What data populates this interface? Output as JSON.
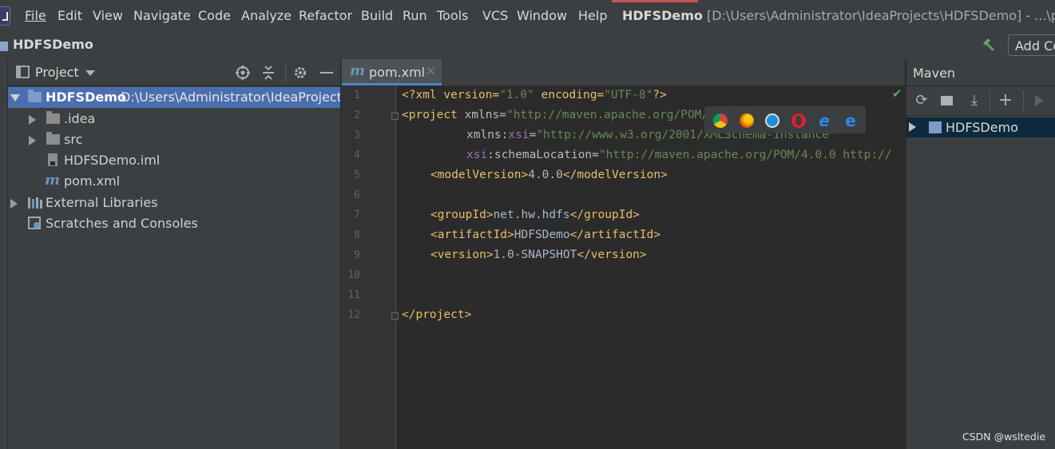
{
  "menubar": {
    "items": [
      "File",
      "Edit",
      "View",
      "Navigate",
      "Code",
      "Analyze",
      "Refactor",
      "Build",
      "Run",
      "Tools",
      "VCS",
      "Window",
      "Help"
    ],
    "title_project": "HDFSDemo",
    "title_path": "[D:\\Users\\Administrator\\IdeaProjects\\HDFSDemo] - ...\\pom.xml"
  },
  "navbar": {
    "project_name": "HDFSDemo",
    "add_config_label": "Add Co"
  },
  "project_panel": {
    "title": "Project",
    "tree": [
      {
        "label": "HDFSDemo",
        "path": "D:\\Users\\Administrator\\IdeaProjects\\H",
        "icon": "module-folder-icon",
        "expanded": true
      },
      {
        "label": ".idea",
        "icon": "folder-icon"
      },
      {
        "label": "src",
        "icon": "folder-icon"
      },
      {
        "label": "HDFSDemo.iml",
        "icon": "iml-file-icon"
      },
      {
        "label": "pom.xml",
        "icon": "maven-file-icon"
      },
      {
        "label": "External Libraries",
        "icon": "libraries-icon"
      },
      {
        "label": "Scratches and Consoles",
        "icon": "scratches-icon"
      }
    ]
  },
  "editor": {
    "tab_label": "pom.xml",
    "tab_icon": "m",
    "line_numbers": [
      "1",
      "2",
      "3",
      "4",
      "5",
      "6",
      "7",
      "8",
      "9",
      "10",
      "11",
      "12"
    ],
    "code": {
      "l1_a": "<?xml version=",
      "l1_b": "\"1.0\"",
      "l1_c": " encoding=",
      "l1_d": "\"UTF-8\"",
      "l1_e": "?>",
      "l2_a": "<project ",
      "l2_b": "xmlns=",
      "l2_c": "\"http://maven.apache.org/POM/4.0.0\"",
      "l3_a": "xmlns:",
      "l3_b": "xsi",
      "l3_c": "=",
      "l3_d": "\"http://www.w3.org/2001/XMLSchema-instance\"",
      "l4_a": "xsi",
      "l4_b": ":schemaLocation=",
      "l4_c": "\"http://maven.apache.org/POM/4.0.0 http://",
      "l5_a": "<modelVersion>",
      "l5_b": "4.0.0",
      "l5_c": "</modelVersion>",
      "l7_a": "<groupId>",
      "l7_b": "net.hw.hdfs",
      "l7_c": "</groupId>",
      "l8_a": "<artifactId>",
      "l8_b": "HDFSDemo",
      "l8_c": "</artifactId>",
      "l9_a": "<version>",
      "l9_b": "1.0-SNAPSHOT",
      "l9_c": "</version>",
      "l12": "</project>"
    },
    "browsers": [
      "chrome-icon",
      "firefox-icon",
      "safari-icon",
      "opera-icon",
      "ie-icon",
      "edge-icon"
    ]
  },
  "maven_panel": {
    "title": "Maven",
    "project": "HDFSDemo",
    "toolbar": [
      "refresh-icon",
      "reimport-folder-icon",
      "download-icon",
      "add-icon",
      "run-icon"
    ]
  },
  "watermark": "CSDN @wsltedie",
  "colors": {
    "background": "#2b2b2b",
    "panel": "#3c3f41",
    "selection": "#4b6eaf",
    "tag": "#e8bf6a",
    "string": "#6a8759",
    "namespace": "#9876aa"
  }
}
